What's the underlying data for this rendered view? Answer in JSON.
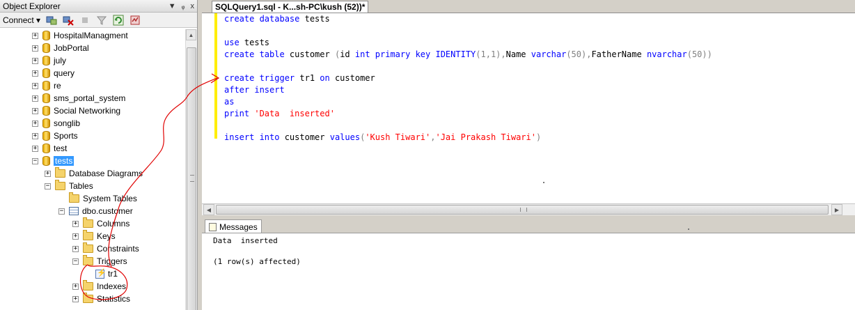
{
  "object_explorer": {
    "title": "Object Explorer",
    "connect_label": "Connect ▾",
    "pin_glyph": "ᵩ",
    "close_glyph": "x",
    "dropdown_glyph": "▼",
    "tree": [
      {
        "label": "HospitalManagment",
        "type": "database",
        "level": 0,
        "expander": "+"
      },
      {
        "label": "JobPortal",
        "type": "database",
        "level": 0,
        "expander": "+"
      },
      {
        "label": "july",
        "type": "database",
        "level": 0,
        "expander": "+"
      },
      {
        "label": "query",
        "type": "database",
        "level": 0,
        "expander": "+"
      },
      {
        "label": "re",
        "type": "database",
        "level": 0,
        "expander": "+"
      },
      {
        "label": "sms_portal_system",
        "type": "database",
        "level": 0,
        "expander": "+"
      },
      {
        "label": "Social Networking",
        "type": "database",
        "level": 0,
        "expander": "+"
      },
      {
        "label": "songlib",
        "type": "database",
        "level": 0,
        "expander": "+"
      },
      {
        "label": "Sports",
        "type": "database",
        "level": 0,
        "expander": "+"
      },
      {
        "label": "test",
        "type": "database",
        "level": 0,
        "expander": "+"
      },
      {
        "label": "tests",
        "type": "database",
        "level": 0,
        "expander": "−",
        "selected": true
      },
      {
        "label": "Database Diagrams",
        "type": "folder",
        "level": 1,
        "expander": "+"
      },
      {
        "label": "Tables",
        "type": "folder",
        "level": 1,
        "expander": "−"
      },
      {
        "label": "System Tables",
        "type": "folder",
        "level": 2,
        "expander": ""
      },
      {
        "label": "dbo.customer",
        "type": "table",
        "level": 2,
        "expander": "−"
      },
      {
        "label": "Columns",
        "type": "folder",
        "level": 3,
        "expander": "+"
      },
      {
        "label": "Keys",
        "type": "folder",
        "level": 3,
        "expander": "+"
      },
      {
        "label": "Constraints",
        "type": "folder",
        "level": 3,
        "expander": "+"
      },
      {
        "label": "Triggers",
        "type": "folder",
        "level": 3,
        "expander": "−"
      },
      {
        "label": "tr1",
        "type": "trigger",
        "level": 4,
        "expander": ""
      },
      {
        "label": "Indexes",
        "type": "folder",
        "level": 3,
        "expander": "+"
      },
      {
        "label": "Statistics",
        "type": "folder",
        "level": 3,
        "expander": "+"
      }
    ]
  },
  "editor": {
    "tab_title": "SQLQuery1.sql - K...sh-PC\\kush (52))*",
    "code_lines": [
      [
        {
          "t": "create database",
          "c": "kw"
        },
        {
          "t": " tests",
          "c": ""
        }
      ],
      [],
      [
        {
          "t": "use",
          "c": "kw"
        },
        {
          "t": " tests",
          "c": ""
        }
      ],
      [
        {
          "t": "create table",
          "c": "kw"
        },
        {
          "t": " customer ",
          "c": ""
        },
        {
          "t": "(",
          "c": "gray"
        },
        {
          "t": "id ",
          "c": ""
        },
        {
          "t": "int primary key IDENTITY",
          "c": "kw"
        },
        {
          "t": "(1,1),",
          "c": "gray"
        },
        {
          "t": "Name ",
          "c": ""
        },
        {
          "t": "varchar",
          "c": "kw"
        },
        {
          "t": "(50),",
          "c": "gray"
        },
        {
          "t": "FatherName ",
          "c": ""
        },
        {
          "t": "nvarchar",
          "c": "kw"
        },
        {
          "t": "(50))",
          "c": "gray"
        }
      ],
      [],
      [
        {
          "t": "create trigger",
          "c": "kw"
        },
        {
          "t": " tr1 ",
          "c": ""
        },
        {
          "t": "on",
          "c": "kw"
        },
        {
          "t": " customer",
          "c": ""
        }
      ],
      [
        {
          "t": "after insert",
          "c": "kw"
        }
      ],
      [
        {
          "t": "as",
          "c": "kw"
        }
      ],
      [
        {
          "t": "print",
          "c": "kw"
        },
        {
          "t": " ",
          "c": ""
        },
        {
          "t": "'Data  inserted'",
          "c": "str"
        }
      ],
      [],
      [
        {
          "t": "insert into",
          "c": "kw"
        },
        {
          "t": " customer ",
          "c": ""
        },
        {
          "t": "values",
          "c": "kw"
        },
        {
          "t": "(",
          "c": "gray"
        },
        {
          "t": "'Kush Tiwari'",
          "c": "str"
        },
        {
          "t": ",",
          "c": "gray"
        },
        {
          "t": "'Jai Prakash Tiwari'",
          "c": "str"
        },
        {
          "t": ")",
          "c": "gray"
        }
      ]
    ]
  },
  "results": {
    "tab_label": "Messages",
    "messages": [
      "Data  inserted",
      "",
      "(1 row(s) affected)"
    ]
  },
  "colors": {
    "keyword": "#0000ff",
    "string": "#ff0000",
    "operator": "#808080",
    "annotation": "#e00000",
    "selection": "#3399ff"
  }
}
